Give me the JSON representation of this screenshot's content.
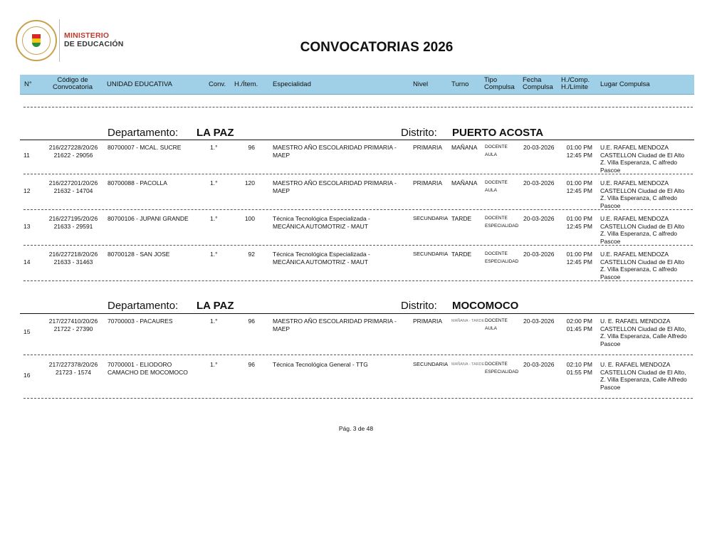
{
  "logo": {
    "line1": "MINISTERIO",
    "line2": "DE EDUCACIÓN"
  },
  "title": "CONVOCATORIAS 2026",
  "columns": {
    "num": "N°",
    "codigo": [
      "Código de",
      "Convocatoria"
    ],
    "unidad": "UNIDAD EDUCATIVA",
    "conv": "Conv.",
    "hitem": "H./Ítem.",
    "especialidad": "Especialidad",
    "nivel": "Nivel",
    "turno": "Turno",
    "tipo": [
      "Tipo",
      "Compulsa"
    ],
    "fecha": [
      "Fecha",
      "Compulsa"
    ],
    "hcomp": [
      "H./Comp.",
      "H./Límite"
    ],
    "lugar": "Lugar Compulsa"
  },
  "sections": [
    {
      "dep_label": "Departamento:",
      "dep_value": "LA PAZ",
      "dist_label": "Distrito:",
      "dist_value": "PUERTO ACOSTA",
      "rows": [
        {
          "num": "11",
          "codigo": [
            "216/227228/20/26",
            "21622 - 29056"
          ],
          "unidad": [
            "80700007 - MCAL. SUCRE"
          ],
          "conv": "1.°",
          "hitem": "96",
          "especialidad": [
            "MAESTRO AÑO ESCOLARIDAD PRIMARIA -",
            "MAEP"
          ],
          "nivel": "PRIMARIA",
          "turno": "MAÑANA",
          "tipo": [
            "DOCENTE",
            "AULA"
          ],
          "fecha": "20-03-2026",
          "hcomp": [
            "01:00 PM",
            "12:45 PM"
          ],
          "lugar": [
            "U.E. RAFAEL MENDOZA",
            "CASTELLON Ciudad de El Alto",
            "Z. Villa Esperanza, C alfredo",
            "Pascoe"
          ]
        },
        {
          "num": "12",
          "codigo": [
            "216/227201/20/26",
            "21632 - 14704"
          ],
          "unidad": [
            "80700088 - PACOLLA"
          ],
          "conv": "1.°",
          "hitem": "120",
          "especialidad": [
            "MAESTRO AÑO ESCOLARIDAD PRIMARIA -",
            "MAEP"
          ],
          "nivel": "PRIMARIA",
          "turno": "MAÑANA",
          "tipo": [
            "DOCENTE",
            "AULA"
          ],
          "fecha": "20-03-2026",
          "hcomp": [
            "01:00 PM",
            "12:45 PM"
          ],
          "lugar": [
            "U.E. RAFAEL MENDOZA",
            "CASTELLON Ciudad de El Alto",
            "Z. Villa Esperanza, C alfredo",
            "Pascoe"
          ]
        },
        {
          "num": "13",
          "codigo": [
            "216/227195/20/26",
            "21633 - 29591"
          ],
          "unidad": [
            "80700106 - JUPANI GRANDE"
          ],
          "conv": "1.°",
          "hitem": "100",
          "especialidad": [
            "Técnica Tecnológica Especializada -",
            "MECÁNICA AUTOMOTRIZ - MAUT"
          ],
          "nivel": "SECUNDARIA",
          "turno": "TARDE",
          "tipo": [
            "DOCENTE",
            "ESPECIALIDAD"
          ],
          "fecha": "20-03-2026",
          "hcomp": [
            "01:00 PM",
            "12:45 PM"
          ],
          "lugar": [
            "U.E. RAFAEL MENDOZA",
            "CASTELLON Ciudad de El Alto",
            "Z. Villa Esperanza, C alfredo",
            "Pascoe"
          ]
        },
        {
          "num": "14",
          "codigo": [
            "216/227218/20/26",
            "21633 - 31463"
          ],
          "unidad": [
            "80700128 - SAN JOSE"
          ],
          "conv": "1.°",
          "hitem": "92",
          "especialidad": [
            "Técnica Tecnológica Especializada -",
            "MECÁNICA AUTOMOTRIZ - MAUT"
          ],
          "nivel": "SECUNDARIA",
          "turno": "TARDE",
          "tipo": [
            "DOCENTE",
            "ESPECIALIDAD"
          ],
          "fecha": "20-03-2026",
          "hcomp": [
            "01:00 PM",
            "12:45 PM"
          ],
          "lugar": [
            "U.E. RAFAEL MENDOZA",
            "CASTELLON Ciudad de El Alto",
            "Z. Villa Esperanza, C alfredo",
            "Pascoe"
          ]
        }
      ]
    },
    {
      "dep_label": "Departamento:",
      "dep_value": "LA PAZ",
      "dist_label": "Distrito:",
      "dist_value": "MOCOMOCO",
      "rows": [
        {
          "num": "15",
          "codigo": [
            "217/227410/20/26",
            "21722 - 27390"
          ],
          "unidad": [
            "70700003 - PACAURES"
          ],
          "conv": "1.°",
          "hitem": "96",
          "especialidad": [
            "MAESTRO AÑO ESCOLARIDAD PRIMARIA -",
            "MAEP"
          ],
          "nivel": "PRIMARIA",
          "turno": "MAÑANA - TARDE",
          "tipo": [
            "DOCENTE",
            "AULA"
          ],
          "fecha": "20-03-2026",
          "hcomp": [
            "02:00 PM",
            "01:45 PM"
          ],
          "lugar": [
            "U. E. RAFAEL MENDOZA",
            "CASTELLON Ciudad de El Alto,",
            "Z. Villa Esperanza, Calle Alfredo",
            "Pascoe"
          ]
        },
        {
          "num": "16",
          "codigo": [
            "217/227378/20/26",
            "21723 - 1574"
          ],
          "unidad": [
            "70700001 - ELIODORO",
            "CAMACHO DE MOCOMOCO"
          ],
          "conv": "1.°",
          "hitem": "96",
          "especialidad": [
            "Técnica Tecnológica General - TTG"
          ],
          "nivel": "SECUNDARIA",
          "turno": "MAÑANA - TARDE",
          "tipo": [
            "DOCENTE",
            "ESPECIALIDAD"
          ],
          "fecha": "20-03-2026",
          "hcomp": [
            "02:10 PM",
            "01:55 PM"
          ],
          "lugar": [
            "U. E. RAFAEL MENDOZA",
            "CASTELLON Ciudad de El Alto,",
            "Z. Villa Esperanza, Calle Alfredo",
            "Pascoe"
          ]
        }
      ]
    }
  ],
  "footer": "Pág. 3 de 48"
}
